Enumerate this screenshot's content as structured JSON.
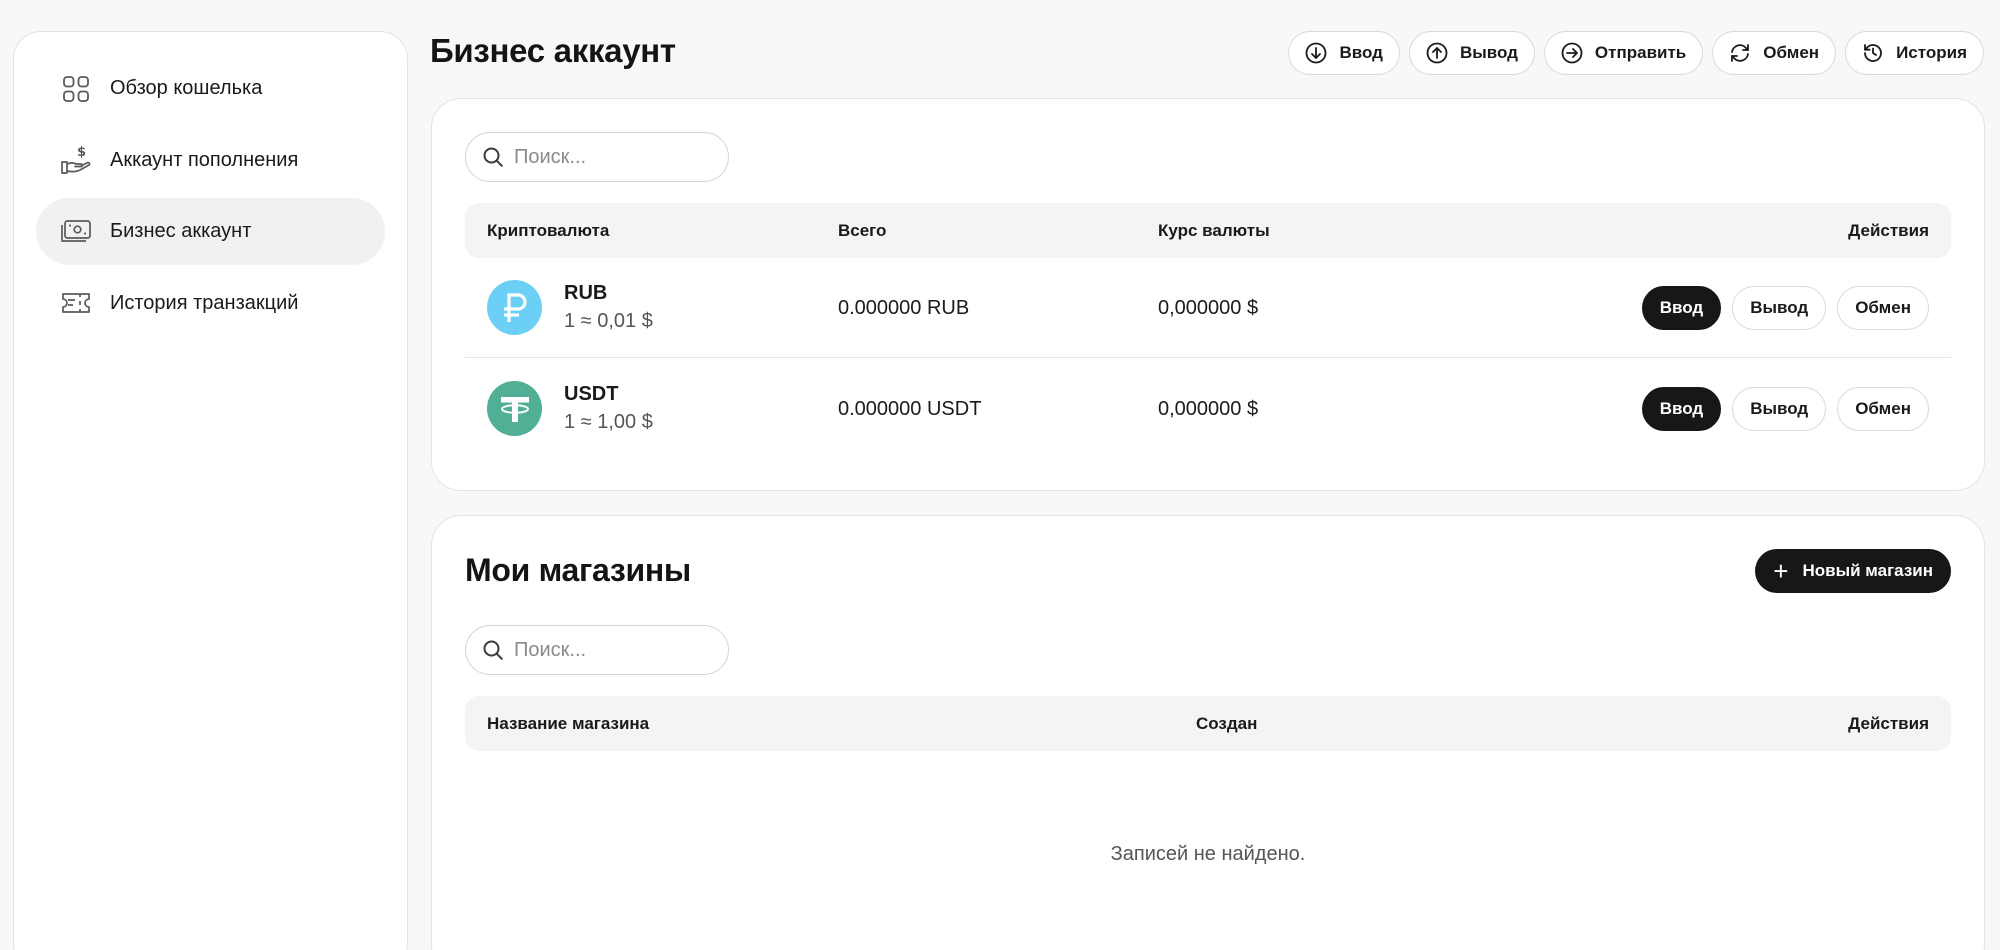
{
  "sidebar": {
    "items": [
      {
        "label": "Обзор кошелька",
        "icon": "grid-icon",
        "active": false
      },
      {
        "label": "Аккаунт пополнения",
        "icon": "hand-dollar-icon",
        "active": false
      },
      {
        "label": "Бизнес аккаунт",
        "icon": "banknote-icon",
        "active": true
      },
      {
        "label": "История транзакций",
        "icon": "ticket-icon",
        "active": false
      }
    ]
  },
  "header": {
    "title": "Бизнес аккаунт",
    "actions": {
      "deposit": "Ввод",
      "withdraw": "Вывод",
      "send": "Отправить",
      "exchange": "Обмен",
      "history": "История"
    }
  },
  "currencies": {
    "search_placeholder": "Поиск...",
    "columns": {
      "currency": "Криптовалюта",
      "total": "Всего",
      "rate": "Курс валюты",
      "actions": "Действия"
    },
    "rows": [
      {
        "name": "RUB",
        "rate_note": "1 ≈ 0,01 $",
        "total": "0.000000 RUB",
        "course": "0,000000 $",
        "icon": "ruble-coin-icon",
        "color": "#6cd0f6"
      },
      {
        "name": "USDT",
        "rate_note": "1 ≈ 1,00 $",
        "total": "0.000000 USDT",
        "course": "0,000000 $",
        "icon": "tether-coin-icon",
        "color": "#50af95"
      }
    ],
    "row_actions": {
      "deposit": "Ввод",
      "withdraw": "Вывод",
      "exchange": "Обмен"
    }
  },
  "shops": {
    "title": "Мои магазины",
    "new_button": "Новый магазин",
    "search_placeholder": "Поиск...",
    "columns": {
      "name": "Название магазина",
      "created": "Создан",
      "actions": "Действия"
    },
    "empty": "Записей не найдено."
  }
}
